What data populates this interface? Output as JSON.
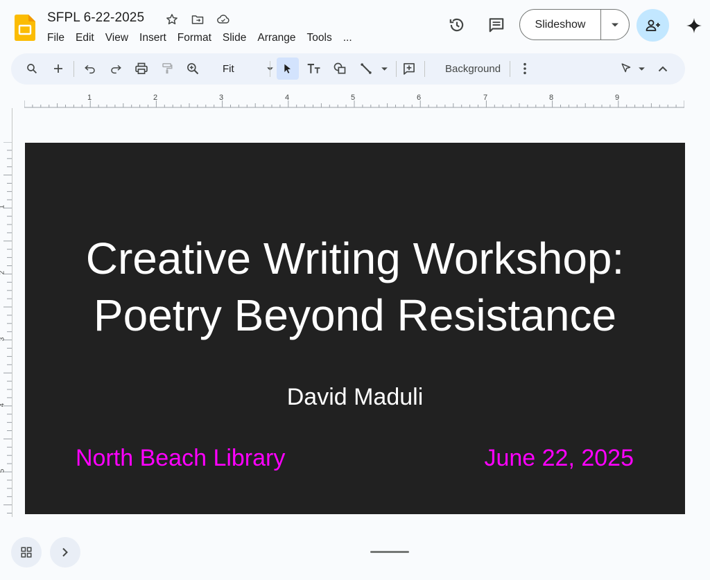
{
  "app": {
    "doc_title": "SFPL 6-22-2025",
    "colors": {
      "accent": "#c2e7ff",
      "slide_bg": "#212121",
      "magenta": "#ff00ff",
      "logo_yellow": "#fbbc04"
    }
  },
  "menu": [
    "File",
    "Edit",
    "View",
    "Insert",
    "Format",
    "Slide",
    "Arrange",
    "Tools",
    "..."
  ],
  "header": {
    "slideshow_label": "Slideshow",
    "icons": [
      "star-icon",
      "move-to-folder-icon",
      "cloud-saved-icon",
      "version-history-icon",
      "comments-icon",
      "add-person-icon",
      "gemini-sparkle-icon"
    ]
  },
  "toolbar": {
    "zoom_value": "Fit",
    "background_label": "Background"
  },
  "ruler": {
    "h_labels": [
      "1",
      "2",
      "3",
      "4",
      "5",
      "6",
      "7",
      "8",
      "9"
    ],
    "v_labels": [
      "1",
      "2",
      "3",
      "4",
      "5"
    ]
  },
  "slide": {
    "title_line1": "Creative Writing Workshop:",
    "title_line2": "Poetry Beyond Resistance",
    "subtitle": "David Maduli",
    "left_text": "North Beach Library",
    "right_text": "June 22, 2025"
  }
}
